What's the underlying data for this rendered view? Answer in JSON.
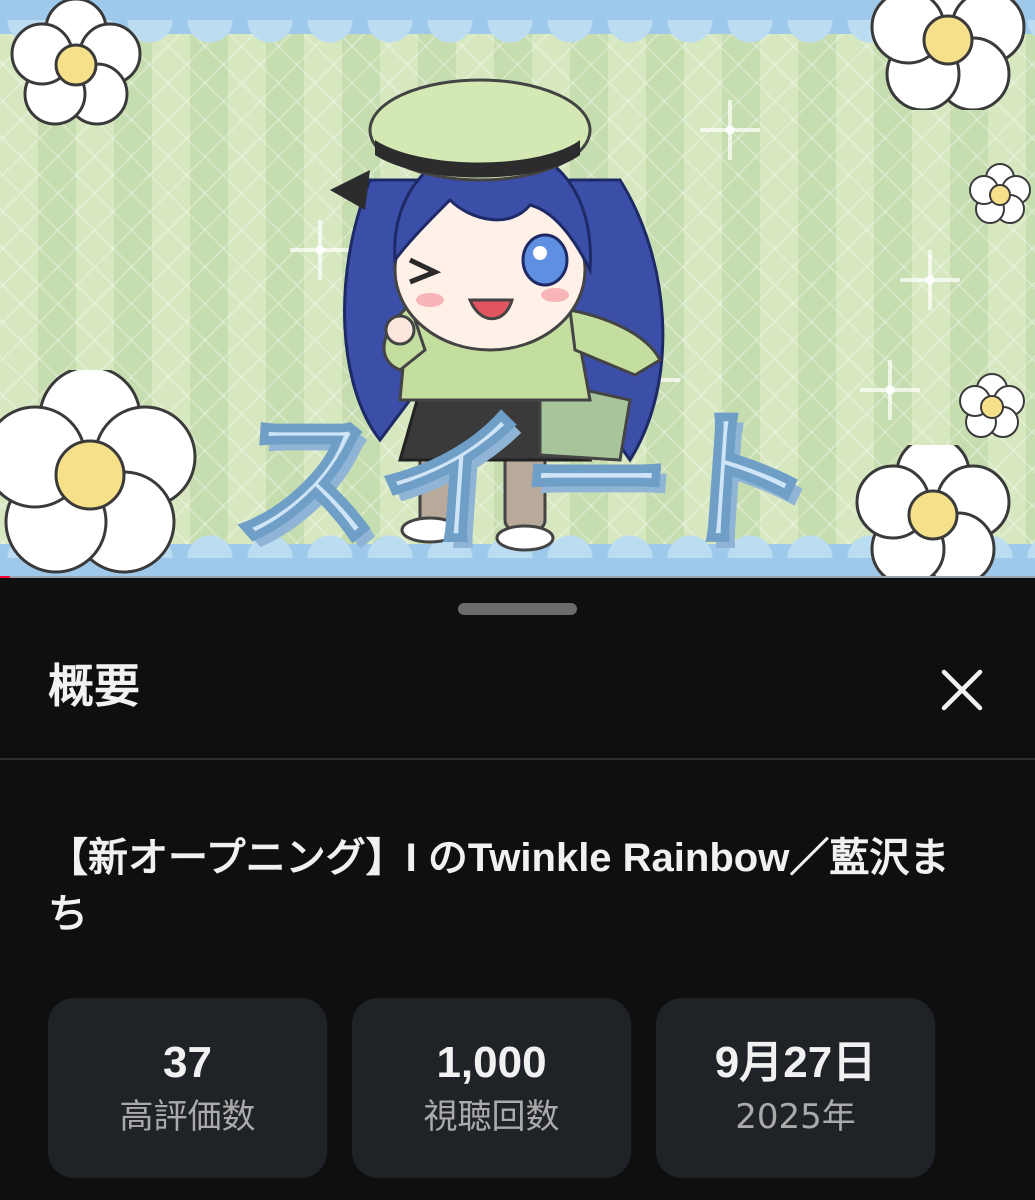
{
  "video": {
    "thumbnail_text": "スイート",
    "progress": 0.01,
    "accent_color": "#ff0033"
  },
  "sheet": {
    "title": "概要",
    "close_icon": "close-icon"
  },
  "description": {
    "title": "【新オープニング】I のTwinkle Rainbow／藍沢まち"
  },
  "stats": [
    {
      "value": "37",
      "label": "高評価数"
    },
    {
      "value": "1,000",
      "label": "視聴回数"
    },
    {
      "value": "9月27日",
      "label": "2025年"
    }
  ]
}
